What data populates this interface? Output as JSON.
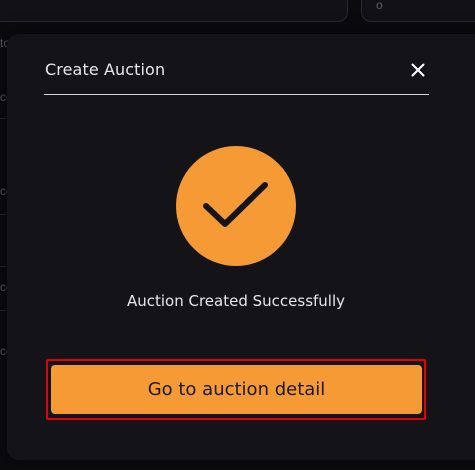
{
  "modal": {
    "title": "Create Auction",
    "close_icon": "close-icon",
    "success_icon": "checkmark-icon",
    "success_message": "Auction Created Successfully",
    "cta_label": "Go to auction detail"
  },
  "background": {
    "fragments": [
      "to",
      "o",
      "ce",
      "ce",
      "ce",
      "ce",
      "ac",
      "ac",
      "ac"
    ]
  },
  "colors": {
    "accent": "#f59a34",
    "modal_bg": "#141418",
    "page_bg": "#0b0b0e",
    "highlight_border": "#e3000b",
    "text_primary": "#e9e9ed"
  }
}
